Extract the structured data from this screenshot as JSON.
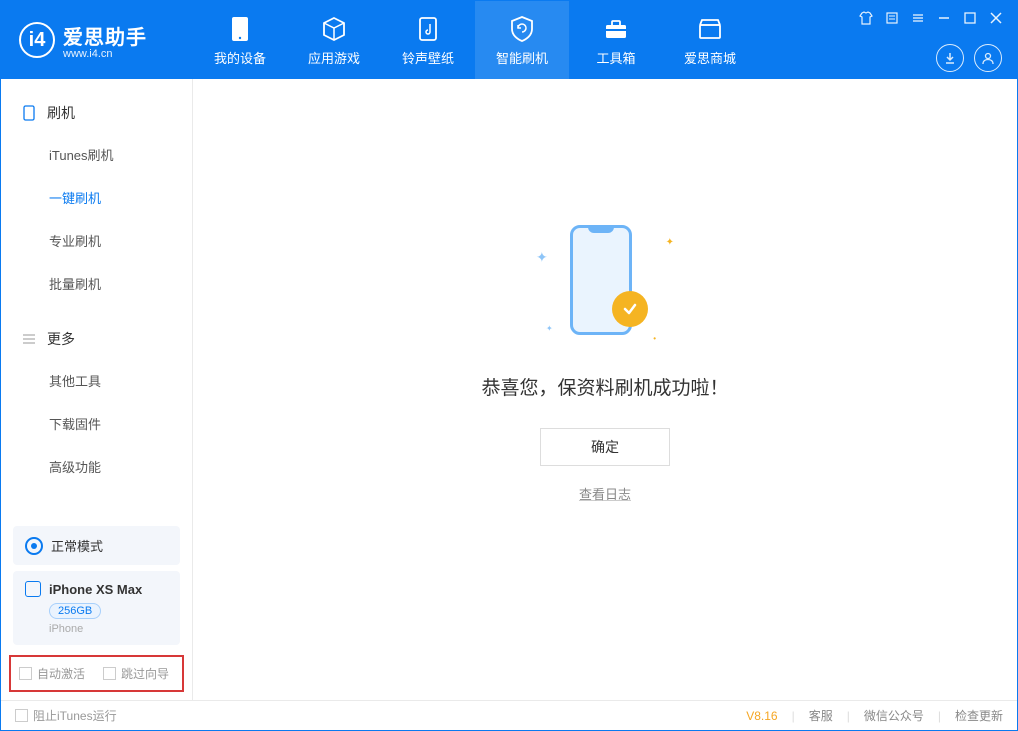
{
  "app": {
    "title": "爱思助手",
    "subtitle": "www.i4.cn"
  },
  "nav": {
    "tabs": [
      {
        "label": "我的设备"
      },
      {
        "label": "应用游戏"
      },
      {
        "label": "铃声壁纸"
      },
      {
        "label": "智能刷机"
      },
      {
        "label": "工具箱"
      },
      {
        "label": "爱思商城"
      }
    ]
  },
  "sidebar": {
    "section1_title": "刷机",
    "items1": [
      {
        "label": "iTunes刷机"
      },
      {
        "label": "一键刷机"
      },
      {
        "label": "专业刷机"
      },
      {
        "label": "批量刷机"
      }
    ],
    "section2_title": "更多",
    "items2": [
      {
        "label": "其他工具"
      },
      {
        "label": "下载固件"
      },
      {
        "label": "高级功能"
      }
    ],
    "mode_label": "正常模式",
    "device": {
      "name": "iPhone XS Max",
      "storage": "256GB",
      "type": "iPhone"
    },
    "checkboxes": {
      "auto_activate": "自动激活",
      "skip_guide": "跳过向导"
    }
  },
  "main": {
    "success_message": "恭喜您，保资料刷机成功啦！",
    "confirm_label": "确定",
    "view_log_label": "查看日志"
  },
  "footer": {
    "block_itunes": "阻止iTunes运行",
    "version": "V8.16",
    "links": {
      "service": "客服",
      "wechat": "微信公众号",
      "update": "检查更新"
    }
  }
}
